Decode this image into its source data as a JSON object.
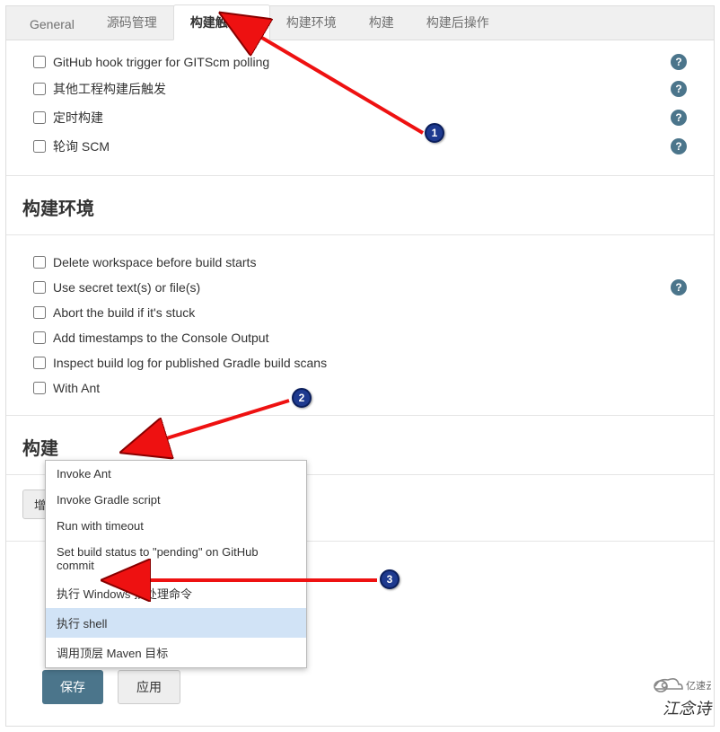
{
  "tabs": {
    "general": "General",
    "scm": "源码管理",
    "triggers": "构建触发器",
    "env": "构建环境",
    "build": "构建",
    "post": "构建后操作"
  },
  "triggers": {
    "github_hook": "GitHub hook trigger for GITScm polling",
    "other_project": "其他工程构建后触发",
    "timed": "定时构建",
    "poll_scm": "轮询 SCM"
  },
  "env": {
    "heading": "构建环境",
    "delete_ws": "Delete workspace before build starts",
    "secret": "Use secret text(s) or file(s)",
    "abort": "Abort the build if it's stuck",
    "timestamps": "Add timestamps to the Console Output",
    "gradle_scan": "Inspect build log for published Gradle build scans",
    "with_ant": "With Ant"
  },
  "build": {
    "heading": "构建",
    "add_step": "增加构建步骤"
  },
  "dropdown": [
    "Invoke Ant",
    "Invoke Gradle script",
    "Run with timeout",
    "Set build status to \"pending\" on GitHub commit",
    "执行 Windows 批处理命令",
    "执行 shell",
    "调用顶层 Maven 目标"
  ],
  "buttons": {
    "save": "保存",
    "apply": "应用"
  },
  "markers": {
    "m1": "1",
    "m2": "2",
    "m3": "3"
  },
  "watermark": "江念诗",
  "logo_text": "亿速云"
}
